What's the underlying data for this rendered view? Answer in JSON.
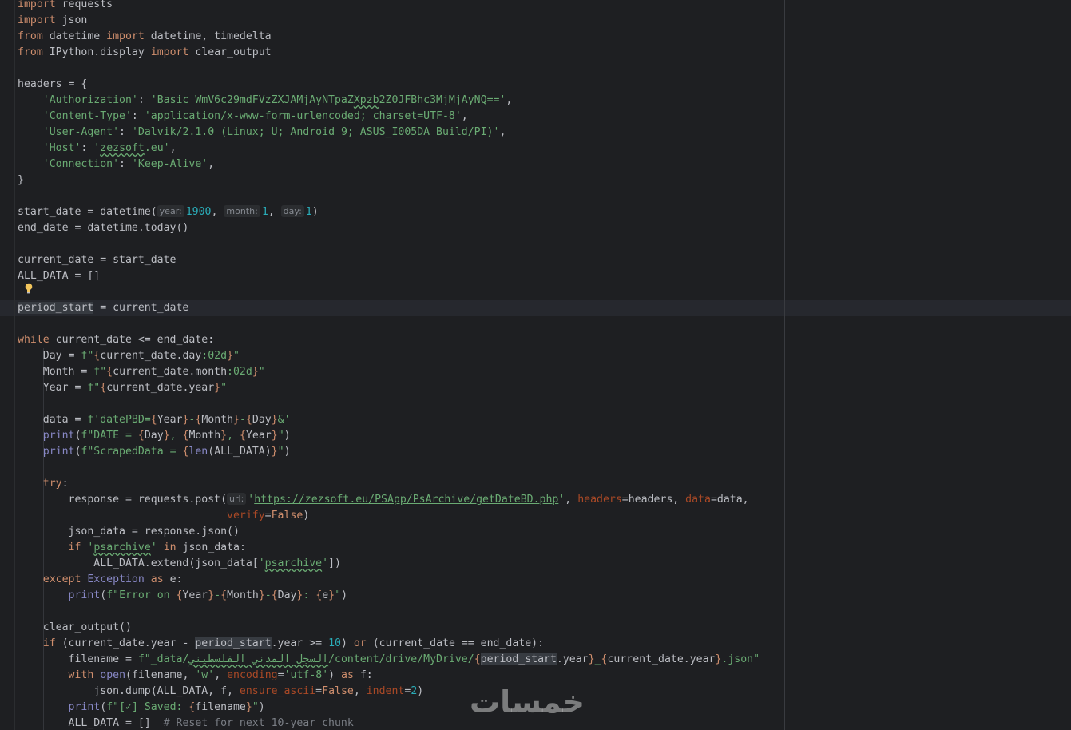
{
  "editor": {
    "colors": {
      "background": "#1e1f22",
      "keyword": "#cf8e6d",
      "string": "#6aab73",
      "number": "#2aacb8",
      "builtin": "#8888c6",
      "parameter": "#aa4926",
      "comment": "#7a7e85",
      "text": "#bcbec4"
    },
    "hints": {
      "year": "year:",
      "month": "month:",
      "day": "day:",
      "url": "url:"
    },
    "code": {
      "l1": "import requests",
      "l2": "import json",
      "l3": "from datetime import datetime, timedelta",
      "l4": "from IPython.display import clear_output",
      "l6": "headers = {",
      "l7_key": "'Authorization'",
      "l7_val": "'Basic WmV6c29mdFVzZXJAMjAyNTpaZXpzb2Z0JFBhc3MjMjAyNQ=='",
      "l8_key": "'Content-Type'",
      "l8_val": "'application/x-www-form-urlencoded; charset=UTF-8'",
      "l9_key": "'User-Agent'",
      "l9_val": "'Dalvik/2.1.0 (Linux; U; Android 9; ASUS_I005DA Build/PI)'",
      "l10_key": "'Host'",
      "l10_val": "'zezsoft.eu'",
      "l11_key": "'Connection'",
      "l11_val": "'Keep-Alive'",
      "l12": "}",
      "l14_a": "start_date = datetime(",
      "l14_year": "1900",
      "l14_month": "1",
      "l14_day": "1",
      "l15": "end_date = datetime.today()",
      "l17": "current_date = start_date",
      "l18": "ALL_DATA = []",
      "l20_var": "period_start",
      "l20_rest": " = current_date",
      "l22": "while current_date <= end_date:",
      "l23": "Day = f\"{current_date.day:02d}\"",
      "l24": "Month = f\"{current_date.month:02d}\"",
      "l25": "Year = f\"{current_date.year}\"",
      "l27": "data = f'datePBD={Year}-{Month}-{Day}&'",
      "l28": "print(f\"DATE = {Day}, {Month}, {Year}\")",
      "l29": "print(f\"ScrapedData = {len(ALL_DATA)}\")",
      "l31": "try:",
      "l32_a": "response = requests.post(",
      "l32_url": "https://zezsoft.eu/PSApp/PsArchive/getDateBD.php",
      "l32_b": "headers=headers, data=data,",
      "l33": "verify=False)",
      "l34": "json_data = response.json()",
      "l35": "if 'psarchive' in json_data:",
      "l36": "ALL_DATA.extend(json_data['psarchive'])",
      "l37": "except Exception as e:",
      "l38": "print(f\"Error on {Year}-{Month}-{Day}: {e}\")",
      "l40": "clear_output()",
      "l41": "if (current_date.year - period_start.year >= 10) or (current_date == end_date):",
      "l42_a": "filename = f\"_data/",
      "l42_arabic": "السجل المدني الفلسطيني",
      "l42_b": "/content/drive/MyDrive/{period_start.year}_{current_date.year}.json\"",
      "l43": "with open(filename, 'w', encoding='utf-8') as f:",
      "l44": "json.dump(ALL_DATA, f, ensure_ascii=False, indent=2)",
      "l45": "print(f\"[✓] Saved: {filename}\")",
      "l46_a": "ALL_DATA = []",
      "l46_cmt": "# Reset for next 10-year chunk"
    }
  },
  "icons": {
    "intention": "lightbulb-icon"
  },
  "watermark": {
    "text": "خمسات"
  }
}
